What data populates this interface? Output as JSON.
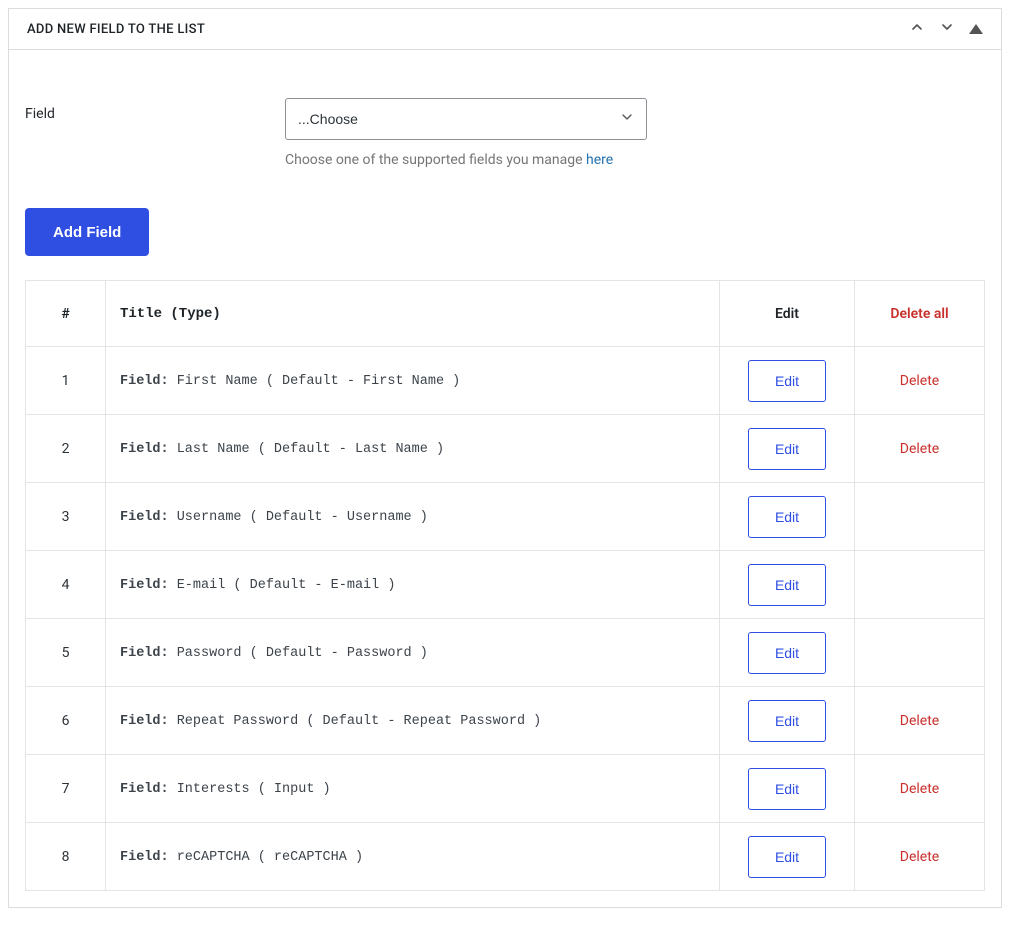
{
  "panel": {
    "title": "ADD NEW FIELD TO THE LIST"
  },
  "form": {
    "fieldLabel": "Field",
    "selectPlaceholder": "...Choose",
    "helpPrefix": "Choose one of the supported fields you manage ",
    "helpLinkText": "here",
    "addButton": "Add Field"
  },
  "table": {
    "headers": {
      "index": "#",
      "title": "Title (Type)",
      "edit": "Edit",
      "deleteAll": "Delete all"
    },
    "fieldPrefix": "Field:",
    "editLabel": "Edit",
    "deleteLabel": "Delete",
    "rows": [
      {
        "num": "1",
        "text": "First Name ( Default - First Name )",
        "deletable": true
      },
      {
        "num": "2",
        "text": "Last Name ( Default - Last Name )",
        "deletable": true
      },
      {
        "num": "3",
        "text": "Username ( Default - Username )",
        "deletable": false
      },
      {
        "num": "4",
        "text": "E-mail ( Default - E-mail )",
        "deletable": false
      },
      {
        "num": "5",
        "text": "Password ( Default - Password )",
        "deletable": false
      },
      {
        "num": "6",
        "text": "Repeat Password ( Default - Repeat Password )",
        "deletable": true
      },
      {
        "num": "7",
        "text": "Interests ( Input )",
        "deletable": true
      },
      {
        "num": "8",
        "text": "reCAPTCHA ( reCAPTCHA )",
        "deletable": true
      }
    ]
  }
}
